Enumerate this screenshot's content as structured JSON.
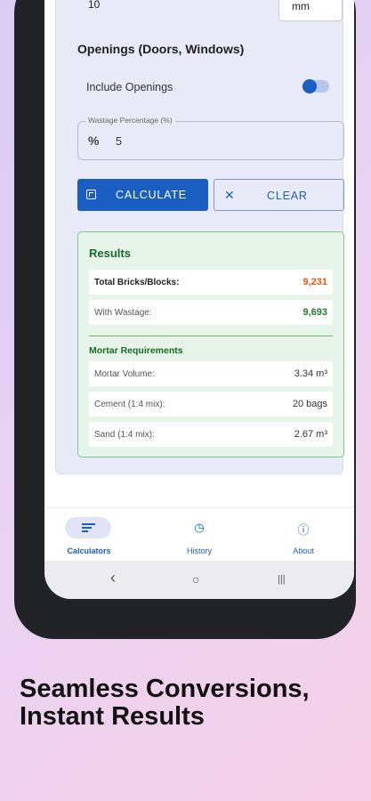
{
  "form": {
    "unit_value": "10",
    "unit_label": "mm",
    "openings_title": "Openings (Doors, Windows)",
    "include_openings_label": "Include Openings",
    "include_openings_on": true,
    "wastage_label": "Wastage Percentage (%)",
    "wastage_prefix": "%",
    "wastage_value": "5",
    "calculate_label": "CALCULATE",
    "clear_label": "CLEAR"
  },
  "results": {
    "title": "Results",
    "total_label": "Total Bricks/Blocks:",
    "total_value": "9,231",
    "wastage_label": "With Wastage:",
    "wastage_value": "9,693",
    "mortar_title": "Mortar Requirements",
    "mortar_volume_label": "Mortar Volume:",
    "mortar_volume_value": "3.34 m³",
    "cement_label": "Cement (1:4 mix):",
    "cement_value": "20 bags",
    "sand_label": "Sand (1:4 mix):",
    "sand_value": "2.67 m³"
  },
  "nav": {
    "calculators": "Calculators",
    "history": "History",
    "about": "About"
  },
  "system_nav": {
    "back": "‹",
    "home": "○",
    "recents": "|||"
  },
  "headline": "Seamless Conversions, Instant Results",
  "colors": {
    "primary": "#1a5ec4",
    "results_green": "#176b25",
    "total_orange": "#e4571f"
  }
}
